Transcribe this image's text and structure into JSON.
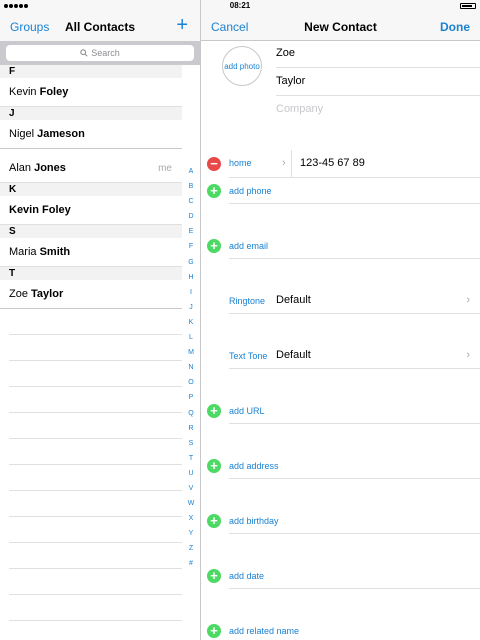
{
  "status_bar": {
    "time": "08:21"
  },
  "left": {
    "nav": {
      "groups": "Groups",
      "title": "All Contacts",
      "add": "+"
    },
    "search": {
      "placeholder": "Search"
    },
    "sections": [
      {
        "letter": "F",
        "rows": [
          {
            "first": "Kevin",
            "last": "Foley",
            "me": ""
          }
        ]
      },
      {
        "letter": "J",
        "rows": [
          {
            "first": "Nigel",
            "last": "Jameson",
            "me": ""
          }
        ]
      },
      {
        "letter": "",
        "rows": [
          {
            "first": "Alan",
            "last": "Jones",
            "me": "me"
          }
        ]
      },
      {
        "letter": "K",
        "rows": [
          {
            "first": "",
            "last": "Kevin Foley",
            "me": ""
          }
        ]
      },
      {
        "letter": "S",
        "rows": [
          {
            "first": "Maria",
            "last": "Smith",
            "me": ""
          }
        ]
      },
      {
        "letter": "T",
        "rows": [
          {
            "first": "Zoe",
            "last": "Taylor",
            "me": ""
          }
        ]
      }
    ],
    "index_letters": [
      "A",
      "B",
      "C",
      "D",
      "E",
      "F",
      "G",
      "H",
      "I",
      "J",
      "K",
      "L",
      "M",
      "N",
      "O",
      "P",
      "Q",
      "R",
      "S",
      "T",
      "U",
      "V",
      "W",
      "X",
      "Y",
      "Z",
      "#"
    ]
  },
  "right": {
    "nav": {
      "cancel": "Cancel",
      "title": "New Contact",
      "done": "Done"
    },
    "add_photo": "add photo",
    "first_name": "Zoe",
    "last_name": "Taylor",
    "company_placeholder": "Company",
    "phone": {
      "label": "home",
      "value": "123-45 67 89"
    },
    "add_phone": "add phone",
    "add_email": "add email",
    "ringtone": {
      "label": "Ringtone",
      "value": "Default"
    },
    "text_tone": {
      "label": "Text Tone",
      "value": "Default"
    },
    "add_url": "add URL",
    "add_address": "add address",
    "add_birthday": "add birthday",
    "add_date": "add date",
    "add_related_name": "add related name"
  },
  "colors": {
    "accent": "#1a82d2",
    "delete": "#e84a4a",
    "add": "#4cd964"
  }
}
